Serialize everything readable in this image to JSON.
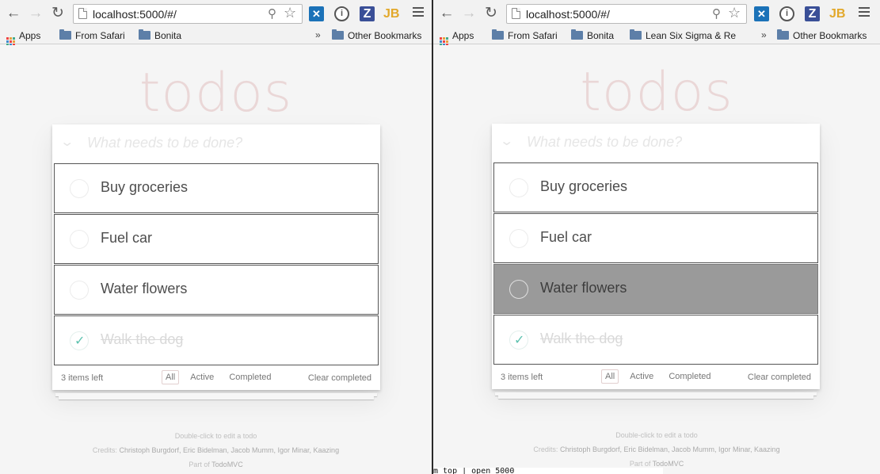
{
  "browser": {
    "url": "localhost:5000/#/",
    "bookmarks_left": [
      "Apps",
      "From Safari",
      "Bonita"
    ],
    "bookmarks_right": [
      "Apps",
      "From Safari",
      "Bonita",
      "Lean Six Sigma & Re"
    ],
    "overflow": "»",
    "other_bookmarks": "Other Bookmarks",
    "extensions": {
      "x": "✕",
      "info": "i",
      "z": "Z",
      "jb": "JB"
    }
  },
  "app": {
    "title": "todos",
    "placeholder": "What needs to be done?",
    "todos": [
      {
        "label": "Buy groceries",
        "done": false
      },
      {
        "label": "Fuel car",
        "done": false
      },
      {
        "label": "Water flowers",
        "done": false
      },
      {
        "label": "Walk the dog",
        "done": true
      }
    ],
    "items_left": "3 items left",
    "filters": [
      "All",
      "Active",
      "Completed"
    ],
    "clear_completed": "Clear completed",
    "info": {
      "hint": "Double-click to edit a todo",
      "credits_prefix": "Credits:",
      "credits_names": "Christoph Burgdorf, Eric Bidelman, Jacob Mumm, Igor Minar, Kaazing",
      "part_of_prefix": "Part of",
      "part_of_link": "TodoMVC"
    }
  },
  "terminal_fragment": "m top | open 5000"
}
